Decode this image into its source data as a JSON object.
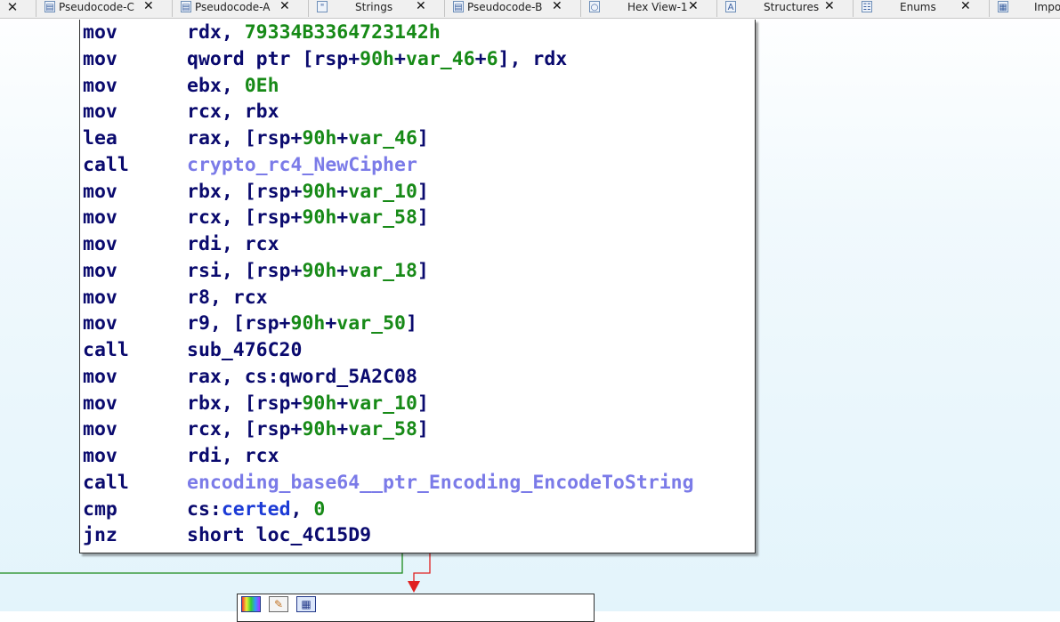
{
  "tabs": [
    {
      "label": "Pseudocode-C",
      "icon": "pseudocode-icon",
      "icon_glyph": "▤",
      "close": "✕"
    },
    {
      "label": "Pseudocode-A",
      "icon": "pseudocode-icon",
      "icon_glyph": "▤",
      "close": "✕"
    },
    {
      "label": "Strings",
      "icon": "strings-icon",
      "icon_glyph": "\"",
      "close": "✕"
    },
    {
      "label": "Pseudocode-B",
      "icon": "pseudocode-icon",
      "icon_glyph": "▤",
      "close": "✕"
    },
    {
      "label": "Hex View-1",
      "icon": "hex-view-icon",
      "icon_glyph": "○",
      "close": "✕"
    },
    {
      "label": "Structures",
      "icon": "structures-icon",
      "icon_glyph": "A",
      "close": "✕"
    },
    {
      "label": "Enums",
      "icon": "enums-icon",
      "icon_glyph": "☷",
      "close": "✕"
    },
    {
      "label": "Impo",
      "icon": "imports-icon",
      "icon_glyph": "▦",
      "close": ""
    }
  ],
  "leading_close": "✕",
  "disassembly": {
    "lines": [
      {
        "mnem": "mov",
        "ops": [
          {
            "t": "rdx, "
          },
          {
            "t": "79334B3364723142h",
            "c": "num"
          }
        ]
      },
      {
        "mnem": "mov",
        "ops": [
          {
            "t": "qword ptr [rsp+"
          },
          {
            "t": "90h",
            "c": "num"
          },
          {
            "t": "+"
          },
          {
            "t": "var_46",
            "c": "var"
          },
          {
            "t": "+"
          },
          {
            "t": "6",
            "c": "num"
          },
          {
            "t": "], rdx"
          }
        ]
      },
      {
        "mnem": "mov",
        "ops": [
          {
            "t": "ebx, "
          },
          {
            "t": "0Eh",
            "c": "num"
          }
        ]
      },
      {
        "mnem": "mov",
        "ops": [
          {
            "t": "rcx, rbx"
          }
        ]
      },
      {
        "mnem": "lea",
        "ops": [
          {
            "t": "rax, [rsp+"
          },
          {
            "t": "90h",
            "c": "num"
          },
          {
            "t": "+"
          },
          {
            "t": "var_46",
            "c": "var"
          },
          {
            "t": "]"
          }
        ]
      },
      {
        "mnem": "call",
        "ops": [
          {
            "t": "crypto_rc4_NewCipher",
            "c": "func"
          }
        ]
      },
      {
        "mnem": "mov",
        "ops": [
          {
            "t": "rbx, [rsp+"
          },
          {
            "t": "90h",
            "c": "num"
          },
          {
            "t": "+"
          },
          {
            "t": "var_10",
            "c": "var"
          },
          {
            "t": "]"
          }
        ]
      },
      {
        "mnem": "mov",
        "ops": [
          {
            "t": "rcx, [rsp+"
          },
          {
            "t": "90h",
            "c": "num"
          },
          {
            "t": "+"
          },
          {
            "t": "var_58",
            "c": "var"
          },
          {
            "t": "]"
          }
        ]
      },
      {
        "mnem": "mov",
        "ops": [
          {
            "t": "rdi, rcx"
          }
        ]
      },
      {
        "mnem": "mov",
        "ops": [
          {
            "t": "rsi, [rsp+"
          },
          {
            "t": "90h",
            "c": "num"
          },
          {
            "t": "+"
          },
          {
            "t": "var_18",
            "c": "var"
          },
          {
            "t": "]"
          }
        ]
      },
      {
        "mnem": "mov",
        "ops": [
          {
            "t": "r8, rcx"
          }
        ]
      },
      {
        "mnem": "mov",
        "ops": [
          {
            "t": "r9, [rsp+"
          },
          {
            "t": "90h",
            "c": "num"
          },
          {
            "t": "+"
          },
          {
            "t": "var_50",
            "c": "var"
          },
          {
            "t": "]"
          }
        ]
      },
      {
        "mnem": "call",
        "ops": [
          {
            "t": "sub_476C20"
          }
        ]
      },
      {
        "mnem": "mov",
        "ops": [
          {
            "t": "rax, cs:qword_5A2C08"
          }
        ]
      },
      {
        "mnem": "mov",
        "ops": [
          {
            "t": "rbx, [rsp+"
          },
          {
            "t": "90h",
            "c": "num"
          },
          {
            "t": "+"
          },
          {
            "t": "var_10",
            "c": "var"
          },
          {
            "t": "]"
          }
        ]
      },
      {
        "mnem": "mov",
        "ops": [
          {
            "t": "rcx, [rsp+"
          },
          {
            "t": "90h",
            "c": "num"
          },
          {
            "t": "+"
          },
          {
            "t": "var_58",
            "c": "var"
          },
          {
            "t": "]"
          }
        ]
      },
      {
        "mnem": "mov",
        "ops": [
          {
            "t": "rdi, rcx"
          }
        ]
      },
      {
        "mnem": "call",
        "ops": [
          {
            "t": "encoding_base64__ptr_Encoding_EncodeToString",
            "c": "func"
          }
        ]
      },
      {
        "mnem": "cmp",
        "ops": [
          {
            "t": "cs:"
          },
          {
            "t": "certed",
            "c": "glob"
          },
          {
            "t": ", "
          },
          {
            "t": "0",
            "c": "num"
          }
        ]
      },
      {
        "mnem": "jnz",
        "ops": [
          {
            "t": "short loc_4C15D9"
          }
        ]
      }
    ]
  },
  "colors": {
    "mnemonic": "#0a0a6e",
    "number": "#178a17",
    "function": "#7b7be8",
    "global": "#1c3bd6",
    "edge_true": "#1a8a1a",
    "edge_false": "#e02020"
  },
  "next_node_icons": [
    "color-palette-icon",
    "edit-node-icon",
    "graph-view-icon"
  ]
}
